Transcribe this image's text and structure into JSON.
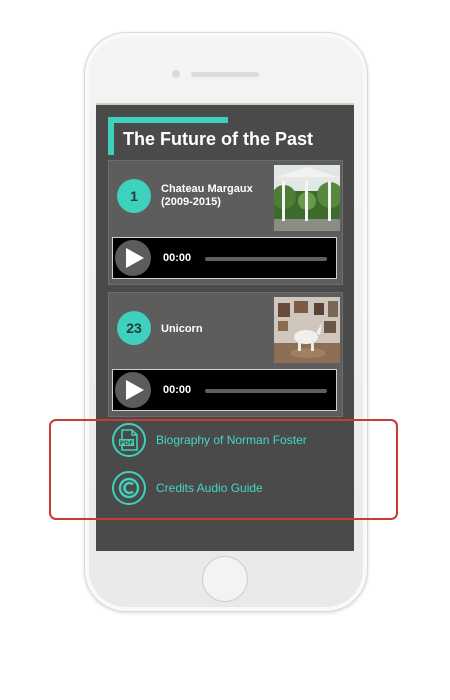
{
  "page": {
    "title": "The Future of the Past"
  },
  "tracks": [
    {
      "number": "1",
      "title": "Chateau Margaux (2009-2015)",
      "thumbnail": "pavilion-photo",
      "player": {
        "time": "00:00",
        "progress": 0
      }
    },
    {
      "number": "23",
      "title": "Unicorn",
      "thumbnail": "gallery-unicorn-photo",
      "player": {
        "time": "00:00",
        "progress": 0
      }
    }
  ],
  "links": [
    {
      "label": "Biography of Norman Foster",
      "icon": "pdf-icon"
    },
    {
      "label": "Credits Audio Guide",
      "icon": "copyright-icon"
    }
  ],
  "colors": {
    "accent": "#3ed1bd",
    "screen_bg": "#4a4a4a",
    "card_bg": "#5d5d5d",
    "highlight": "#c63b32"
  }
}
